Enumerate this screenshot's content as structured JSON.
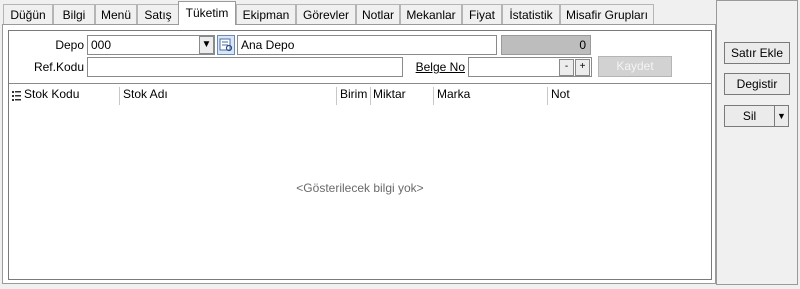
{
  "tabs": [
    {
      "label": "Düğün"
    },
    {
      "label": "Bilgi"
    },
    {
      "label": "Menü"
    },
    {
      "label": "Satış"
    },
    {
      "label": "Tüketim",
      "active": true
    },
    {
      "label": "Ekipman"
    },
    {
      "label": "Görevler"
    },
    {
      "label": "Notlar"
    },
    {
      "label": "Mekanlar"
    },
    {
      "label": "Fiyat"
    },
    {
      "label": "İstatistik"
    },
    {
      "label": "Misafir Grupları"
    }
  ],
  "form": {
    "depo_label": "Depo",
    "depo_value": "000",
    "depo_name": "Ana Depo",
    "depo_count": "0",
    "refkodu_label": "Ref.Kodu",
    "refkodu_value": "",
    "belgeno_label": "Belge No",
    "belgeno_value": "",
    "minus": "-",
    "plus": "+",
    "kaydet_label": "Kaydet"
  },
  "grid": {
    "columns": [
      "Stok Kodu",
      "Stok Adı",
      "Birim",
      "Miktar",
      "Marka",
      "Not"
    ],
    "empty_text": "<Gösterilecek bilgi yok>"
  },
  "actions": {
    "satir_ekle": "Satır Ekle",
    "degistir": "Degistir",
    "sil": "Sil"
  }
}
